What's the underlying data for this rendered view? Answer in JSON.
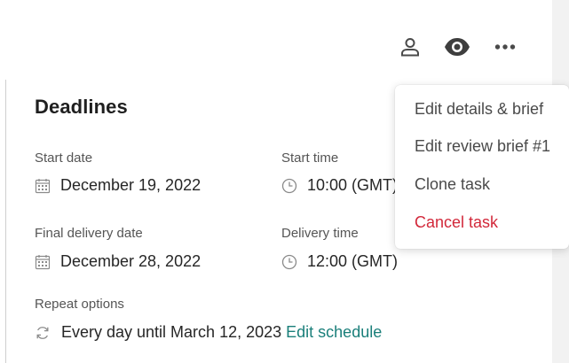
{
  "toolbar": {
    "assignee_icon": "person-icon",
    "watch_icon": "eye-icon",
    "more_icon": "ellipsis-icon"
  },
  "deadlines": {
    "title": "Deadlines",
    "start_date_label": "Start date",
    "start_date_value": "December 19, 2022",
    "start_time_label": "Start time",
    "start_time_value": "10:00 (GMT)",
    "final_delivery_label": "Final delivery date",
    "final_delivery_value": "December 28, 2022",
    "delivery_time_label": "Delivery time",
    "delivery_time_value": "12:00 (GMT)",
    "repeat_label": "Repeat options",
    "repeat_value": "Every day until March 12, 2023",
    "edit_schedule_link": "Edit schedule"
  },
  "menu": {
    "items": [
      {
        "label": "Edit details & brief",
        "kind": "normal"
      },
      {
        "label": "Edit review brief #1",
        "kind": "normal"
      },
      {
        "label": "Clone task",
        "kind": "normal"
      },
      {
        "label": "Cancel task",
        "kind": "danger"
      }
    ]
  },
  "colors": {
    "link": "#1a7f7a",
    "danger": "#d2283a",
    "icon": "#4a4a4a"
  }
}
